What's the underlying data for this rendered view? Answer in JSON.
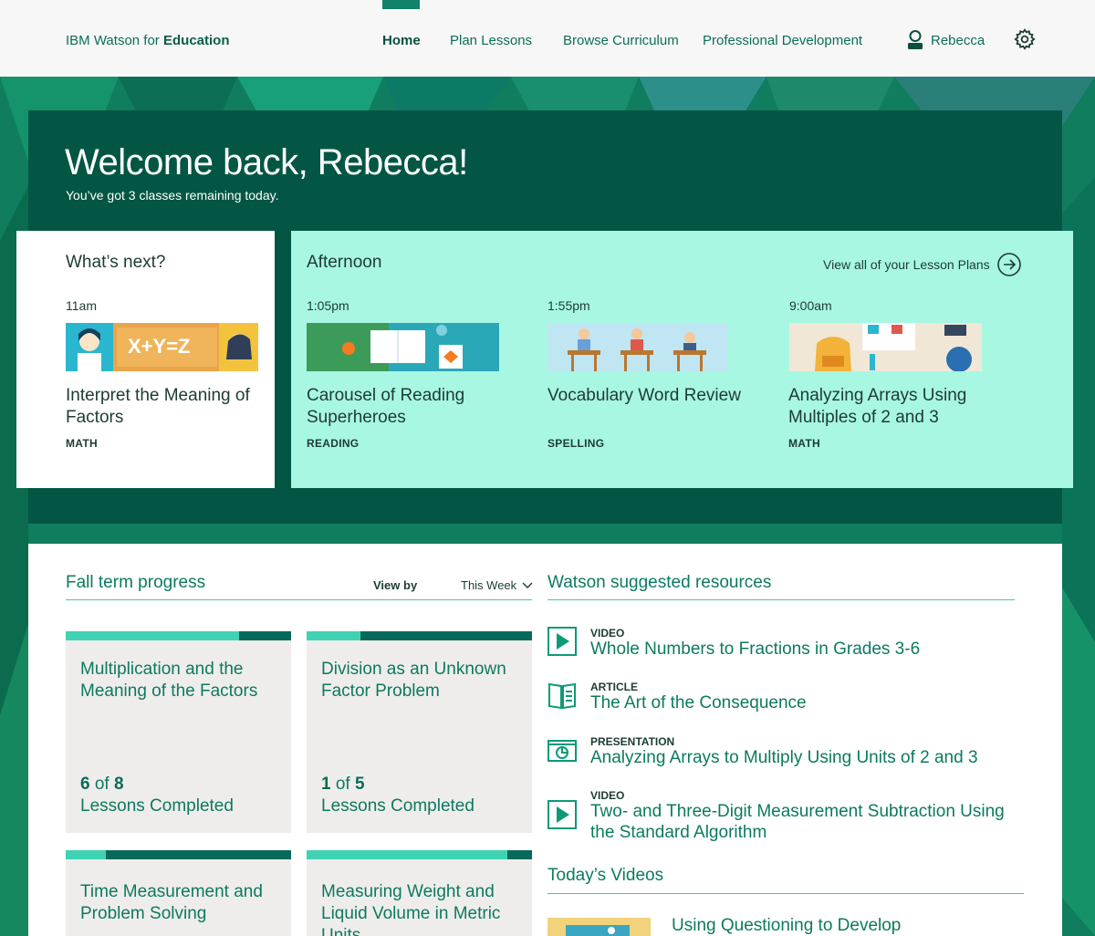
{
  "nav": {
    "brand_prefix": "IBM Watson for ",
    "brand_bold": "Education",
    "items": [
      "Home",
      "Plan Lessons",
      "Browse Curriculum",
      "Professional Development"
    ],
    "active_item": "Home",
    "user_name": "Rebecca",
    "icons": {
      "user": "user-icon",
      "settings": "gear-icon"
    }
  },
  "welcome": {
    "title": "Welcome back, Rebecca!",
    "subtitle": "You’ve got 3 classes remaining today."
  },
  "whats_next": {
    "heading": "What’s next?",
    "lesson": {
      "time": "11am",
      "title": "Interpret the Meaning of Factors",
      "subject": "MATH",
      "thumb_text": "X+Y=Z"
    }
  },
  "afternoon": {
    "heading": "Afternoon",
    "view_all_label": "View all of your Lesson Plans",
    "lessons": [
      {
        "time": "1:05pm",
        "title": "Carousel of Reading Superheroes",
        "subject": "READING"
      },
      {
        "time": "1:55pm",
        "title": "Vocabulary Word Review",
        "subject": "SPELLING"
      },
      {
        "time": "9:00am",
        "title": "Analyzing Arrays Using Multiples of 2 and 3",
        "subject": "MATH"
      }
    ]
  },
  "progress": {
    "heading": "Fall term progress",
    "view_by_label": "View by",
    "view_by_value": "This Week",
    "count_suffix": "Lessons Completed",
    "cards": [
      {
        "title": "Multiplication and the Meaning of the Factors",
        "done": "6",
        "of_label": "of",
        "total": "8",
        "fraction": 0.77
      },
      {
        "title": "Division as an Unknown Factor Problem",
        "done": "1",
        "of_label": "of",
        "total": "5",
        "fraction": 0.24
      },
      {
        "title": "Time Measurement and Problem Solving",
        "fraction": 0.18
      },
      {
        "title": "Measuring Weight and Liquid Volume in Metric Units",
        "fraction": 0.89
      }
    ]
  },
  "resources": {
    "heading": "Watson suggested resources",
    "items": [
      {
        "type": "VIDEO",
        "title": "Whole Numbers to Fractions in Grades 3-6",
        "icon": "video-play-icon"
      },
      {
        "type": "ARTICLE",
        "title": "The Art of the Consequence",
        "icon": "article-book-icon"
      },
      {
        "type": "PRESENTATION",
        "title": "Analyzing Arrays to Multiply Using Units of 2 and 3",
        "icon": "presentation-chart-icon"
      },
      {
        "type": "VIDEO",
        "title": "Two- and Three-Digit Measurement Subtraction Using the Standard Algorithm",
        "icon": "video-play-icon"
      }
    ]
  },
  "todays_videos": {
    "heading": "Today’s Videos",
    "items": [
      {
        "title": "Using Questioning to Develop"
      }
    ]
  },
  "colors": {
    "primary": "#0c7a60",
    "dark_green": "#045644",
    "mint": "#a8f7e2",
    "teal_fill": "#3fd2b3",
    "card_grey": "#efedeb"
  }
}
